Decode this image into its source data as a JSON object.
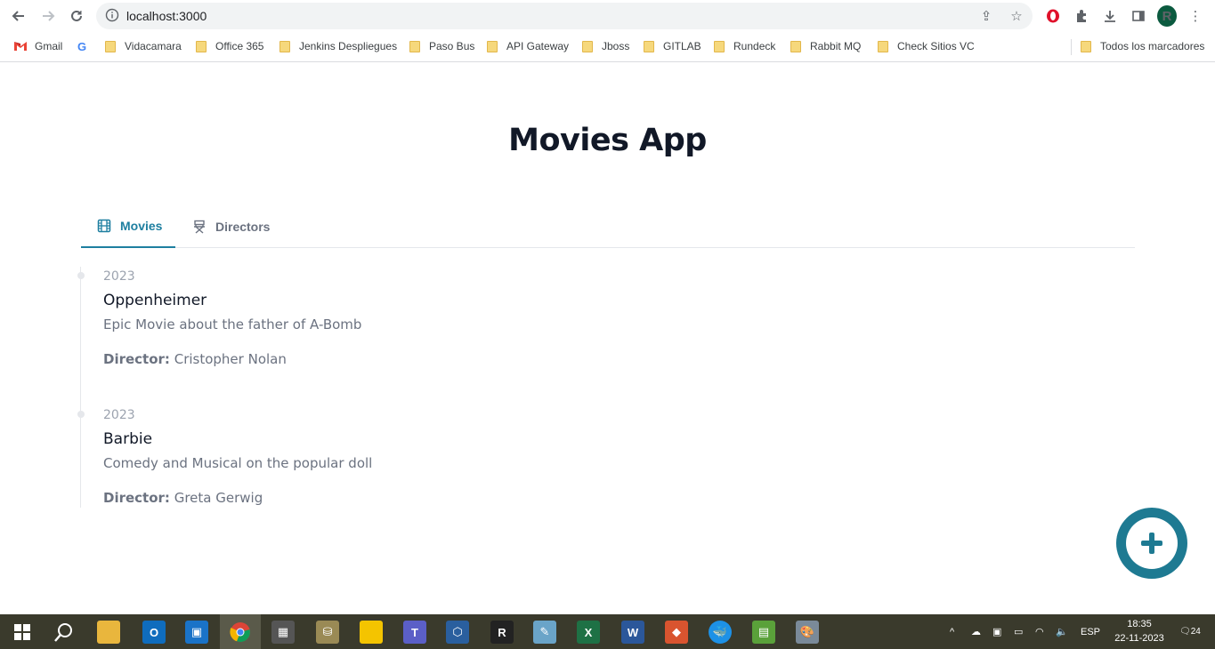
{
  "browser": {
    "url": "localhost:3000",
    "profile_initial": "R",
    "bookmarks": [
      {
        "label": "Gmail",
        "type": "gmail"
      },
      {
        "label": "",
        "type": "google"
      },
      {
        "label": "Vidacamara",
        "type": "folder"
      },
      {
        "label": "Office 365",
        "type": "folder"
      },
      {
        "label": "Jenkins Despliegues",
        "type": "folder"
      },
      {
        "label": "Paso Bus",
        "type": "folder"
      },
      {
        "label": "API Gateway",
        "type": "folder"
      },
      {
        "label": "Jboss",
        "type": "folder"
      },
      {
        "label": "GITLAB",
        "type": "folder"
      },
      {
        "label": "Rundeck",
        "type": "folder"
      },
      {
        "label": "Rabbit MQ",
        "type": "folder"
      },
      {
        "label": "Check Sitios VC",
        "type": "folder"
      }
    ],
    "all_bookmarks_label": "Todos los marcadores"
  },
  "app": {
    "title": "Movies App",
    "tabs": [
      {
        "label": "Movies",
        "active": true,
        "icon": "film-icon"
      },
      {
        "label": "Directors",
        "active": false,
        "icon": "director-chair-icon"
      }
    ],
    "director_label": "Director:",
    "movies": [
      {
        "year": "2023",
        "title": "Oppenheimer",
        "description": "Epic Movie about the father of A-Bomb",
        "director": "Cristopher Nolan"
      },
      {
        "year": "2023",
        "title": "Barbie",
        "description": "Comedy and Musical on the popular doll",
        "director": "Greta Gerwig"
      }
    ],
    "accent_color": "#1e7a92"
  },
  "taskbar": {
    "language": "ESP",
    "time": "18:35",
    "date": "22-11-2023",
    "notifications": "24"
  }
}
